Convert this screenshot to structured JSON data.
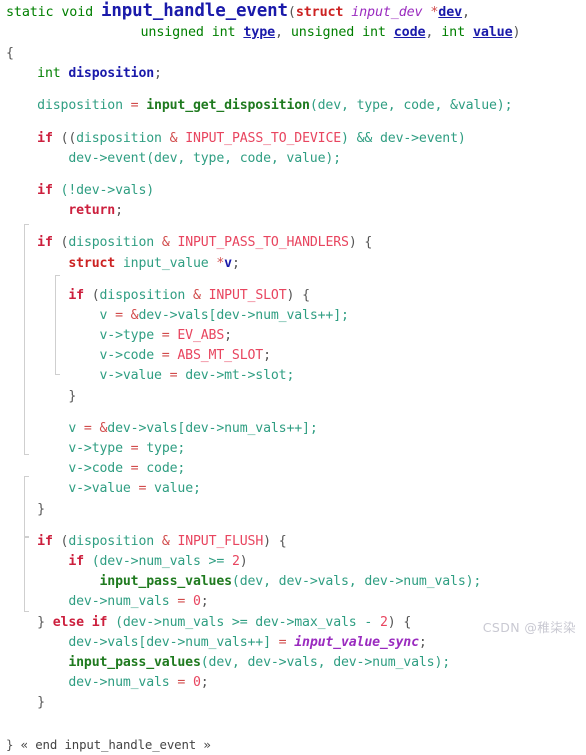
{
  "editor": {
    "language": "C",
    "background_color": "#ffffff",
    "palette": {
      "keyword": "#007f00",
      "function_name": "#1a1aaa",
      "function_call": "#1f7a1f",
      "control": "#cc1f3d",
      "struct_keyword": "#cc2222",
      "type_italic": "#9a2bbf",
      "parameter": "#1a1aaa",
      "variable": "#2f9e82",
      "macro": "#e8455f",
      "number": "#e8455f",
      "operator": "#d14b4b",
      "punctuation": "#555555",
      "fold_guide": "#cfcfcf",
      "watermark": "#c9c9d2"
    }
  },
  "code": {
    "signature": {
      "storage": "static void",
      "name": "input_handle_event",
      "open_paren": "(",
      "struct_kw": "struct",
      "param_type": "input_dev",
      "star": "*",
      "param_dev": "dev",
      "comma": ",",
      "line2_unsigned_int_a": "unsigned int",
      "param_type_name": "type",
      "line2_unsigned_int_b": "unsigned int",
      "param_code": "code",
      "line2_int": "int",
      "param_value": "value",
      "close_paren": ")"
    },
    "body": {
      "open_brace": "{",
      "decl_int": "int",
      "decl_name": "disposition",
      "decl_semi": ";",
      "assign_lhs": "disposition",
      "assign_eq": "=",
      "assign_fn": "input_get_disposition",
      "assign_args": "(dev, type, code, &value);",
      "if_pass_device": "if",
      "if_pass_device_open": "((",
      "if_pass_device_var": "disposition",
      "if_pass_device_amp": "&",
      "if_pass_device_macro": "INPUT_PASS_TO_DEVICE",
      "if_pass_device_and": ") && ",
      "if_pass_device_tail": "dev->event)",
      "call_dev_event": "dev->event(dev, type, code, value);",
      "if_not_vals": "if",
      "if_not_vals_cond": " (!dev->vals)",
      "return_kw": "return",
      "return_semi": ";",
      "if_handlers": "if",
      "if_handlers_open": " (",
      "if_handlers_var": "disposition",
      "if_handlers_amp": "&",
      "if_handlers_macro": "INPUT_PASS_TO_HANDLERS",
      "if_handlers_close": ") {",
      "struct_kw2": "struct",
      "struct_type2": "input_value",
      "struct_star2": "*",
      "struct_var2": "v",
      "struct_semi2": ";",
      "if_slot": "if",
      "if_slot_open": " (",
      "if_slot_var": "disposition",
      "if_slot_amp": "&",
      "if_slot_macro": "INPUT_SLOT",
      "if_slot_close": ") {",
      "slot_assign_v": "v",
      "slot_assign_eq": " = ",
      "slot_assign_amp": "&",
      "slot_assign_rest": "dev->vals[dev->num_vals++];",
      "slot_type_lhs": "v->type",
      "slot_type_eq": " = ",
      "slot_type_rhs": "EV_ABS",
      "slot_type_semi": ";",
      "slot_code_lhs": "v->code",
      "slot_code_eq": " = ",
      "slot_code_rhs": "ABS_MT_SLOT",
      "slot_code_semi": ";",
      "slot_value_lhs": "v->value",
      "slot_value_eq": " = ",
      "slot_value_rhs": "dev->mt->slot;",
      "slot_close_brace": "}",
      "v_assign": "v",
      "v_assign_eq": " = ",
      "v_assign_amp": "&",
      "v_assign_rest": "dev->vals[dev->num_vals++];",
      "v_type_lhs": "v->type",
      "v_type_eq": " = ",
      "v_type_rhs": "type;",
      "v_code_lhs": "v->code",
      "v_code_eq": " = ",
      "v_code_rhs": "code;",
      "v_value_lhs": "v->value",
      "v_value_eq": " = ",
      "v_value_rhs": "value;",
      "handlers_close_brace": "}",
      "if_flush": "if",
      "if_flush_open": " (",
      "if_flush_var": "disposition",
      "if_flush_amp": "&",
      "if_flush_macro": "INPUT_FLUSH",
      "if_flush_close": ") {",
      "if_numvals": "if",
      "if_numvals_cond_a": " (dev->num_vals >= ",
      "if_numvals_num": "2",
      "if_numvals_cond_b": ")",
      "flush_call_fn": "input_pass_values",
      "flush_call_args": "(dev, dev->vals, dev->num_vals);",
      "flush_reset_lhs": "dev->num_vals",
      "flush_reset_eq": " = ",
      "flush_reset_num": "0",
      "flush_reset_semi": ";",
      "else_brace": "}",
      "else_kw": "else if",
      "else_cond_a": " (dev->num_vals >= dev->max_vals - ",
      "else_num": "2",
      "else_cond_b": ") {",
      "else_assign_lhs": "dev->vals[dev->num_vals++]",
      "else_assign_eq": " = ",
      "else_assign_rhs": "input_value_sync",
      "else_assign_semi": ";",
      "else_call_fn": "input_pass_values",
      "else_call_args": "(dev, dev->vals, dev->num_vals);",
      "else_reset_lhs": "dev->num_vals",
      "else_reset_eq": " = ",
      "else_reset_num": "0",
      "else_reset_semi": ";",
      "else_close_brace": "}",
      "final_brace": "}",
      "end_comment": "« end input_handle_event »"
    }
  },
  "watermark": {
    "text": "CSDN @稚柒染"
  }
}
